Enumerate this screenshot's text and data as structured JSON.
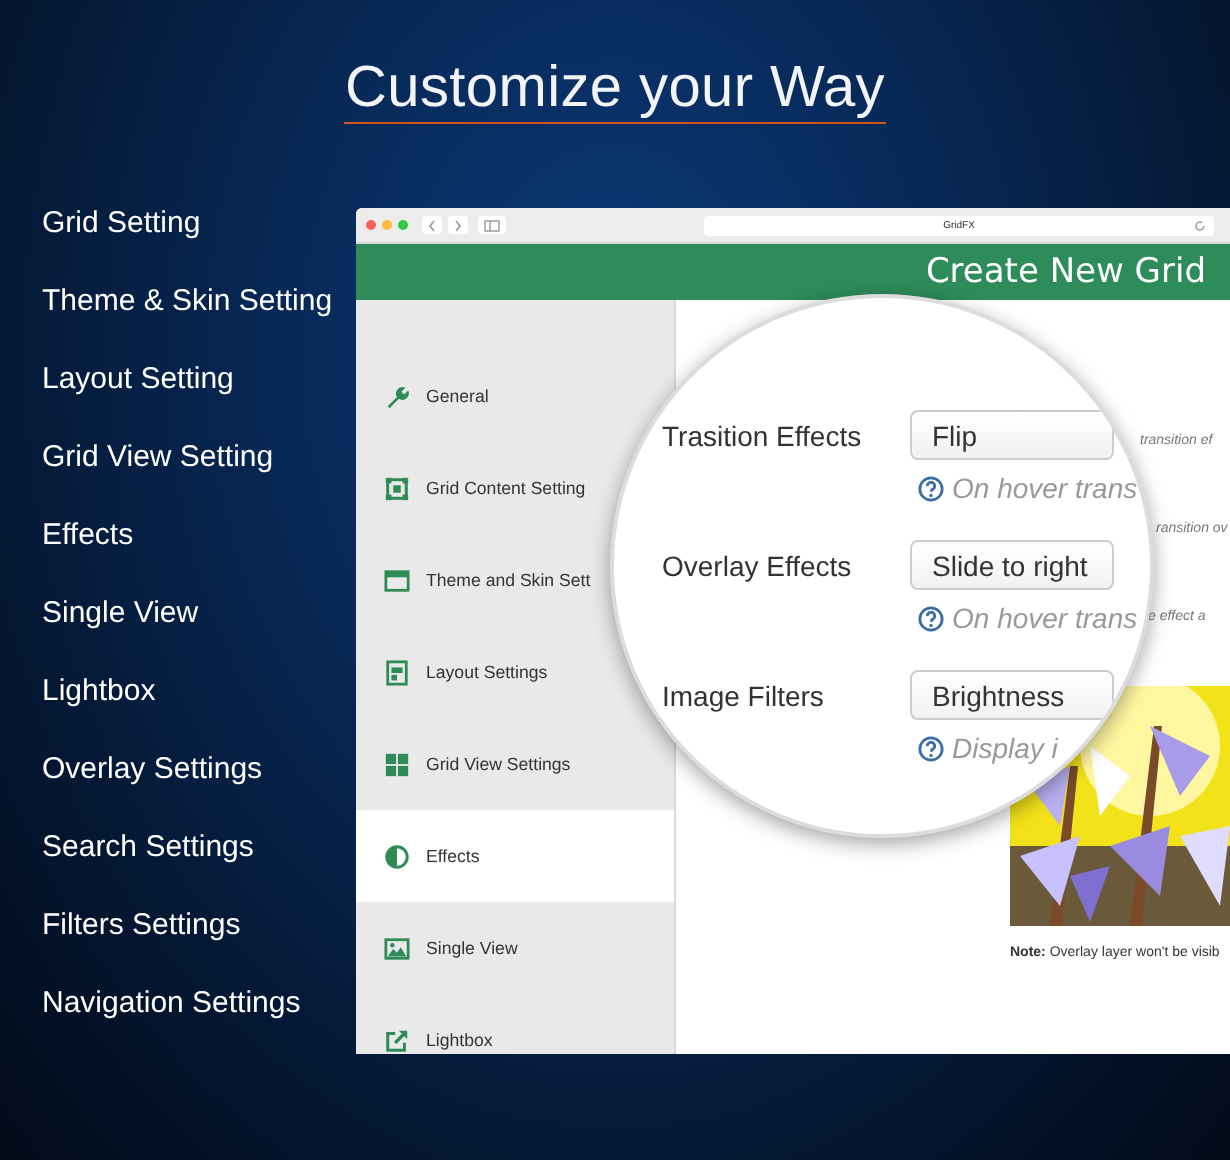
{
  "headline": "Customize your Way",
  "menu": [
    "Grid Setting",
    "Theme & Skin Setting",
    "Layout Setting",
    "Grid View Setting",
    "Effects",
    "Single View",
    "Lightbox",
    "Overlay Settings",
    "Search Settings",
    "Filters Settings",
    "Navigation Settings"
  ],
  "browser": {
    "address": "GridFX"
  },
  "app": {
    "title": "Create New Grid",
    "sidebar": [
      {
        "label": "General",
        "selected": false
      },
      {
        "label": "Grid Content Setting",
        "selected": false
      },
      {
        "label": "Theme and Skin Sett",
        "selected": false
      },
      {
        "label": "Layout Settings",
        "selected": false
      },
      {
        "label": "Grid View Settings",
        "selected": false
      },
      {
        "label": "Effects",
        "selected": true
      },
      {
        "label": "Single View",
        "selected": false
      },
      {
        "label": "Lightbox",
        "selected": false
      }
    ],
    "background_hints": [
      "transition ef",
      "ransition ov",
      "e effect a"
    ],
    "note": "**Note:** Overlay layer won't be visib",
    "magnifier": {
      "fields": [
        {
          "label": "Trasition Effects",
          "value": "Flip",
          "hint": "On hover trans"
        },
        {
          "label": "Overlay Effects",
          "value": "Slide to right",
          "hint": "On hover trans"
        },
        {
          "label": "Image Filters",
          "value": "Brightness",
          "hint": "Display i"
        }
      ]
    }
  }
}
